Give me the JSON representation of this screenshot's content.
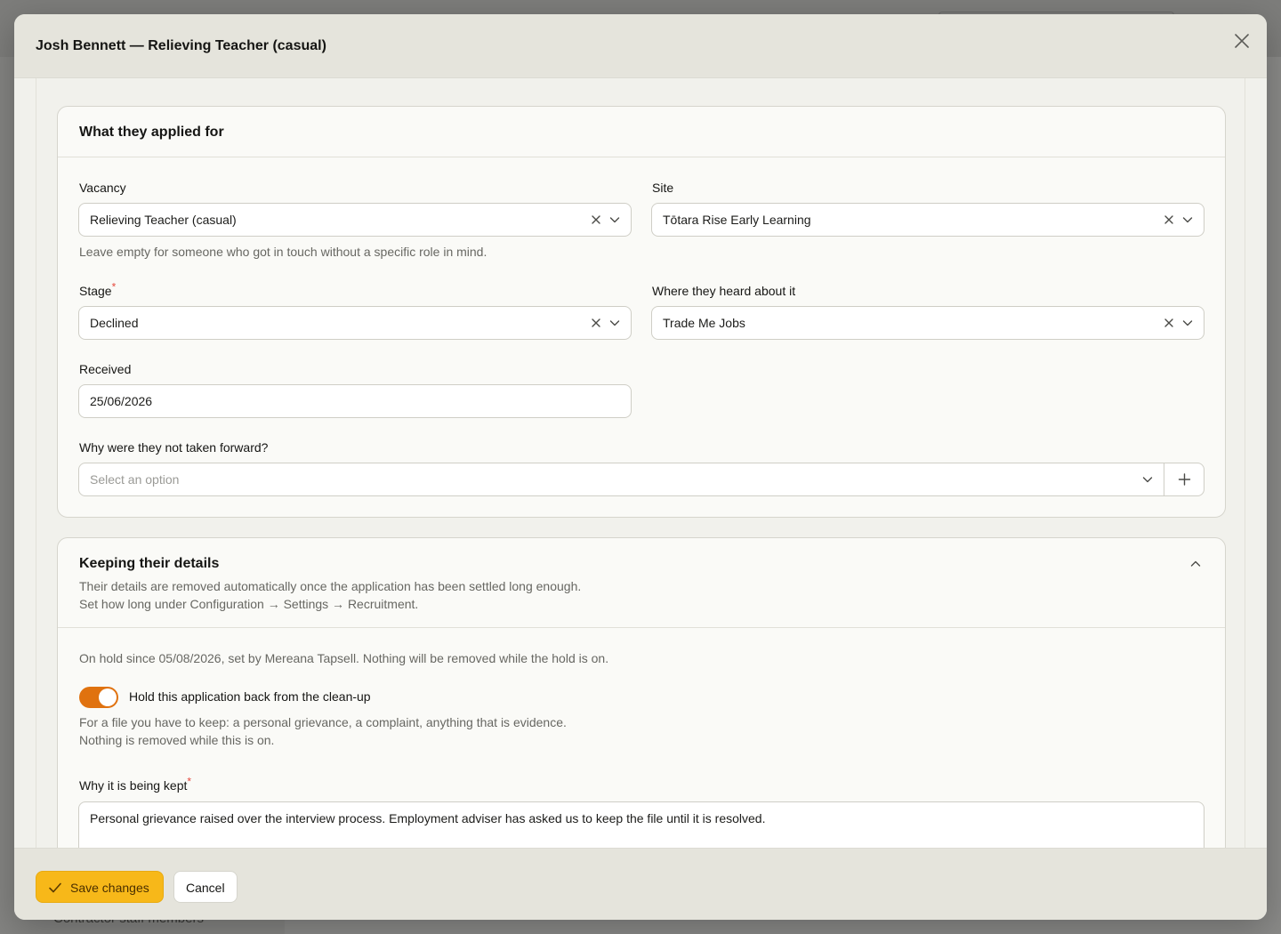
{
  "background": {
    "sidebar_partial_text": "Contractor staff members"
  },
  "modal": {
    "title": "Josh Bennett — Relieving Teacher (casual)",
    "close_icon": "close-icon"
  },
  "applied_section": {
    "title": "What they applied for",
    "vacancy": {
      "label": "Vacancy",
      "value": "Relieving Teacher (casual)",
      "hint": "Leave empty for someone who got in touch without a specific role in mind."
    },
    "site": {
      "label": "Site",
      "value": "Tōtara Rise Early Learning"
    },
    "stage": {
      "label": "Stage",
      "required_mark": "*",
      "value": "Declined"
    },
    "source": {
      "label": "Where they heard about it",
      "value": "Trade Me Jobs"
    },
    "received": {
      "label": "Received",
      "value": "25/06/2026"
    },
    "decline_reason": {
      "label": "Why were they not taken forward?",
      "placeholder": "Select an option"
    }
  },
  "retention_section": {
    "title": "Keeping their details",
    "description_line1": "Their details are removed automatically once the application has been settled long enough.",
    "description_line2": "Set how long under Configuration → Settings → Recruitment.",
    "hold_status": "On hold since 05/08/2026, set by Mereana Tapsell. Nothing will be removed while the hold is on.",
    "hold_toggle": {
      "label": "Hold this application back from the clean-up",
      "on": true,
      "hint_line1": "For a file you have to keep: a personal grievance, a complaint, anything that is evidence.",
      "hint_line2": "Nothing is removed while this is on."
    },
    "reason": {
      "label": "Why it is being kept",
      "required_mark": "*",
      "value": "Personal grievance raised over the interview process. Employment adviser has asked us to keep the file until it is resolved."
    }
  },
  "footer": {
    "save_label": "Save changes",
    "cancel_label": "Cancel"
  },
  "colors": {
    "accent_save": "#f7b819",
    "toggle_on": "#e0720f",
    "required": "#e5483d"
  }
}
